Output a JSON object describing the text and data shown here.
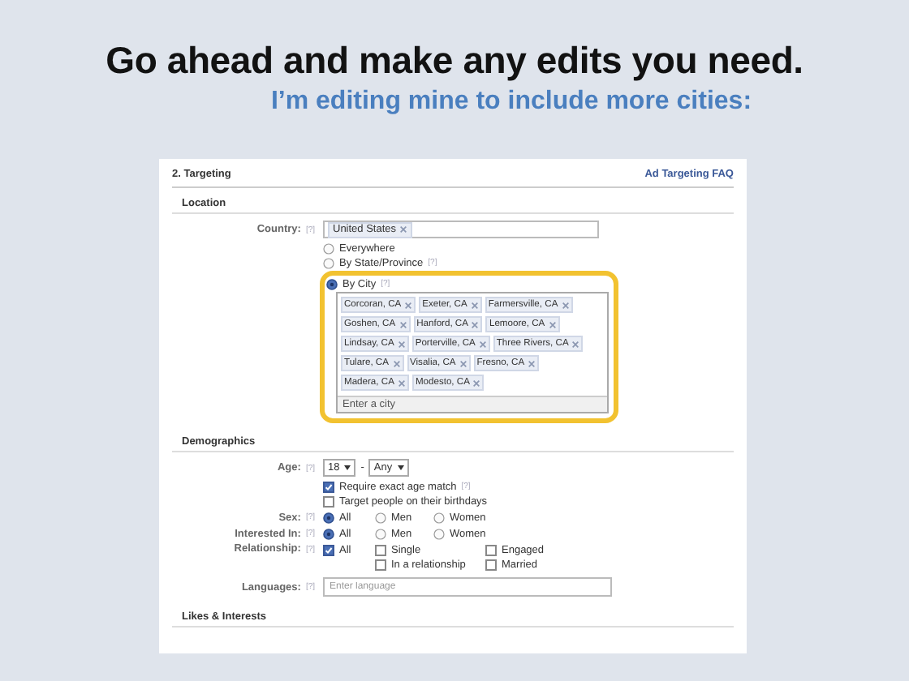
{
  "slide": {
    "title": "Go ahead and make any edits you need.",
    "subtitle": "I’m editing mine to include more cities:"
  },
  "panel": {
    "title": "2. Targeting",
    "faq_link": "Ad Targeting FAQ"
  },
  "location": {
    "heading": "Location",
    "country_label": "Country:",
    "country_help": "[?]",
    "country_tokens": [
      "United States"
    ],
    "scopes": [
      {
        "label": "Everywhere",
        "selected": false
      },
      {
        "label": "By State/Province",
        "help": "[?]",
        "selected": false
      },
      {
        "label": "By City",
        "help": "[?]",
        "selected": true
      }
    ],
    "city_tokens": [
      "Corcoran, CA",
      "Exeter, CA",
      "Farmersville, CA",
      "Goshen, CA",
      "Hanford, CA",
      "Lemoore, CA",
      "Lindsay, CA",
      "Porterville, CA",
      "Three Rivers, CA",
      "Tulare, CA",
      "Visalia, CA",
      "Fresno, CA",
      "Madera, CA",
      "Modesto, CA"
    ],
    "city_placeholder": "Enter a city"
  },
  "demographics": {
    "heading": "Demographics",
    "age_label": "Age:",
    "age_help": "[?]",
    "age_min": "18",
    "age_separator": "-",
    "age_max": "Any",
    "age_options": [
      {
        "label": "Require exact age match",
        "help": "[?]",
        "checked": true
      },
      {
        "label": "Target people on their birthdays",
        "checked": false
      }
    ],
    "sex": {
      "label": "Sex:",
      "help": "[?]",
      "options": [
        {
          "label": "All",
          "selected": true
        },
        {
          "label": "Men",
          "selected": false
        },
        {
          "label": "Women",
          "selected": false
        }
      ]
    },
    "interested_in": {
      "label": "Interested In:",
      "help": "[?]",
      "options": [
        {
          "label": "All",
          "selected": true
        },
        {
          "label": "Men",
          "selected": false
        },
        {
          "label": "Women",
          "selected": false
        }
      ]
    },
    "relationship": {
      "label": "Relationship:",
      "help": "[?]",
      "options": [
        {
          "label": "All",
          "checked": true
        },
        {
          "label": "Single",
          "checked": false
        },
        {
          "label": "Engaged",
          "checked": false
        },
        {
          "label": "In a relationship",
          "checked": false
        },
        {
          "label": "Married",
          "checked": false
        }
      ]
    },
    "languages": {
      "label": "Languages:",
      "help": "[?]",
      "placeholder": "Enter language"
    }
  },
  "likes": {
    "heading": "Likes & Interests"
  }
}
